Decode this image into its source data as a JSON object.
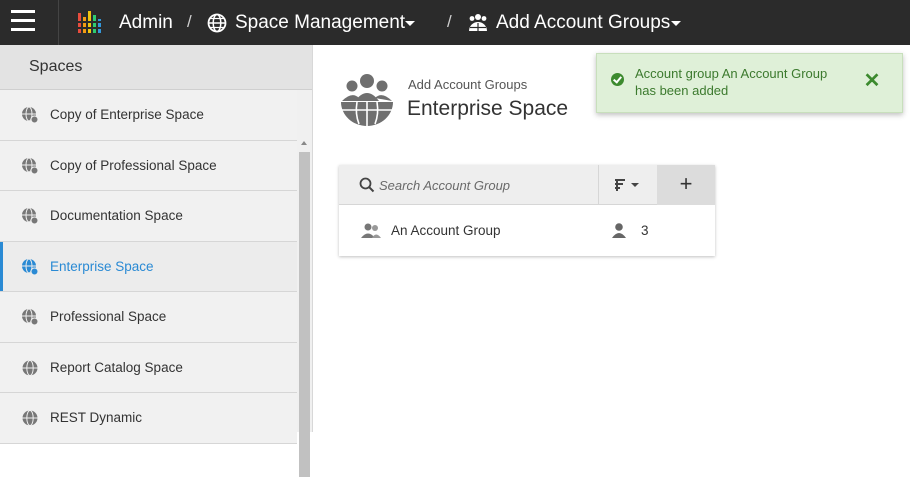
{
  "topbar": {
    "admin_label": "Admin",
    "separator": "/",
    "space_management_label": "Space Management",
    "add_account_groups_label": "Add Account Groups"
  },
  "sidebar": {
    "title": "Spaces",
    "items": [
      {
        "label": "Copy of Enterprise Space"
      },
      {
        "label": "Copy of Professional Space"
      },
      {
        "label": "Documentation Space"
      },
      {
        "label": "Enterprise Space"
      },
      {
        "label": "Professional Space"
      },
      {
        "label": "Report Catalog Space"
      },
      {
        "label": "REST Dynamic"
      }
    ],
    "active_item": "Enterprise Space"
  },
  "main": {
    "subtitle": "Add Account Groups",
    "title": "Enterprise Space",
    "search": {
      "placeholder": "Search Account Group",
      "value": ""
    },
    "add_label": "+",
    "groups": [
      {
        "name": "An Account Group",
        "members": "3"
      }
    ]
  },
  "toast": {
    "message": "Account group An Account Group has been added",
    "close_label": "✕",
    "status_color": "#3c8a2e"
  },
  "colors": {
    "topbar_bg": "#2b2b2b",
    "accent": "#2a8ad4",
    "toast_bg": "#dff0d8"
  }
}
